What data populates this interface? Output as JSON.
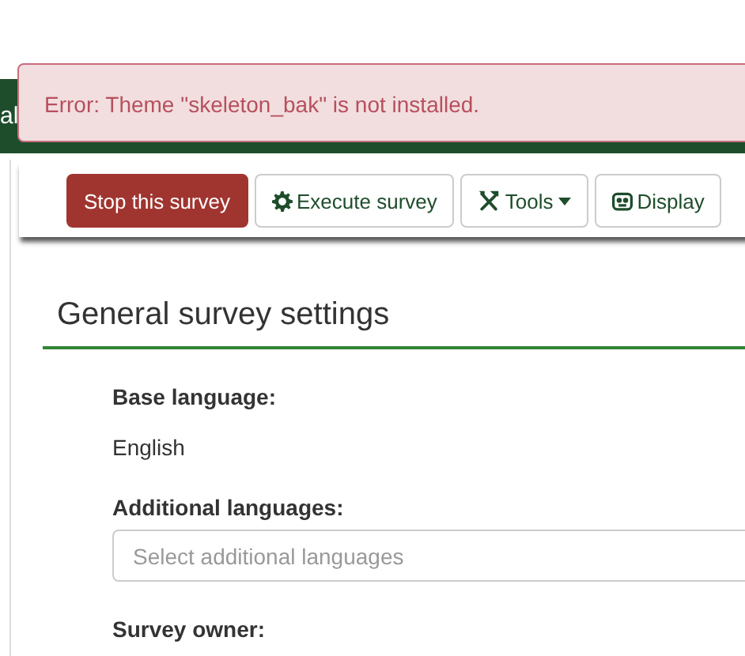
{
  "top_bar": {
    "title_fragment": "al"
  },
  "alert": {
    "kind": "error",
    "message": "Error: Theme \"skeleton_bak\" is not installed."
  },
  "toolbar": [
    {
      "kind": "danger",
      "label": "Stop this survey"
    },
    {
      "kind": "execute",
      "label": "Execute survey"
    },
    {
      "kind": "tools",
      "label": "Tools"
    },
    {
      "kind": "display",
      "label": "Display"
    }
  ],
  "section": {
    "title": "General survey settings",
    "fields": [
      {
        "kind": "text",
        "label": "Base language:",
        "value": "English"
      },
      {
        "kind": "select",
        "label": "Additional languages:",
        "placeholder": "Select additional languages"
      },
      {
        "kind": "heading",
        "label": "Survey owner:"
      }
    ]
  }
}
